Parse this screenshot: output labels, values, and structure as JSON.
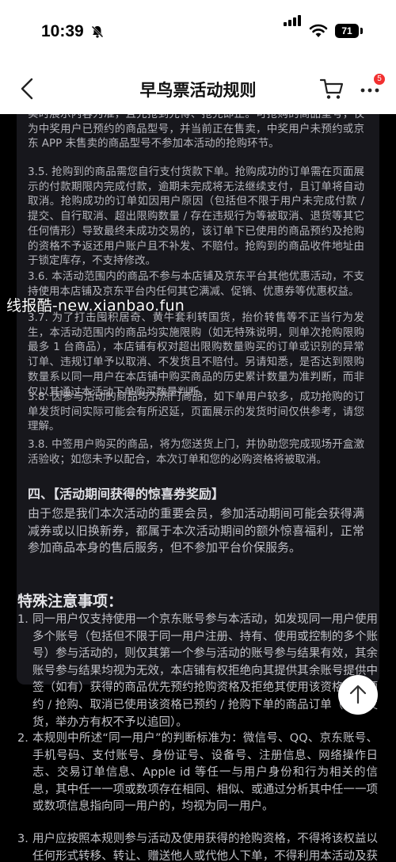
{
  "status": {
    "time": "10:39",
    "battery": "71"
  },
  "nav": {
    "title": "早鸟票活动规则",
    "badge_count": "5"
  },
  "rules": [
    "实时展示内容为准，且先抢到先得、抢完即止。可抢购的商品型号，仅为中奖用户已预约的商品型号，并当前正在售卖，中奖用户未预约或京东 APP 未售卖的商品型号不参加本活动的抢购环节。",
    "3.5. 抢购到的商品需您自行支付货款下单。抢购成功的订单需在页面展示的付款期限内完成付款，逾期未完成将无法继续支付，且订单将自动取消。抢购成功的订单如因用户原因（包括但不限于用户未完成付款 / 提交、自行取消、超出限购数量 / 存在违规行为等被取消、退货等其它任何情形）导致最终未成功交易的，该订单下已使用的商品预约及抢购的资格不予返还用户账户且不补发、不赔付。抢购到的商品收件地址由于锁定库存，不支持修改。",
    "3.6. 本活动范围内的商品不参与本店铺及京东平台其他优惠活动，不支持使用本店铺及京东平台内任何其它满减、促销、优惠券等优惠权益。",
    "3.7. 为了打击囤积居奇、黄牛套利转国货，抬价转售等不正当行为发生，本活动范围内的商品均实施限购（如无特殊说明，则单次抢购限购最多 1 台商品），本店铺有权对超出限购数量购买的订单或识别的异常订单、违规订单予以取消、不发货且不赔付。另请知悉，是否达到限购数量系以同一用户在本店铺中购买商品的历史累计数量为准判断，而非仅以其通过本活动下单购买数量判断。",
    "3.8. 因参与活动的商品均为热门商品，如下单用户较多，成功抢购的订单发货时间实际可能会有所迟延，页面展示的发货时间仅供参考，请您理解。",
    "3.8. 中签用户购买的商品，将为您送货上门，并协助您完成现场开盒激活验收；如您未予以配合，本次订单和您的必购资格将被取消。"
  ],
  "section4": {
    "title": "四、【活动期间获得的惊喜券奖励】",
    "body": "由于您是我们本次活动的重要会员，参加活动期间可能会获得满减券或以旧换新券，都属于本次活动期间的额外惊喜福利，正常参加商品本身的售后服务，但不参加平台价保服务。"
  },
  "notes": {
    "title": "特殊注意事项：",
    "items": [
      {
        "num": "1.",
        "text": "同一用户仅支持使用一个京东账号参与本活动，如发现同一用户使用多个账号（包括但不限于同一用户注册、持有、使用或控制的多个账号）参与活动的，则仅其第一个参与活动的账号参与结果有效，其余账号参与结果均视为无效，本店铺有权拒绝向其提供其余账号提供中签（如有）获得的商品优先预约抢购资格及拒绝其使用该资格参与预约 / 抢购、取消已使用该资格已预约 / 抢购下单的商品订单（如已发货，举办方有权不予以追回）。"
      },
      {
        "num": "2.",
        "text": "本规则中所述“同一用户”的判断标准为：微信号、QQ、京东账号、手机号码、支付账号、身份证号、设备号、注册信息、网络操作日志、交易订单信息、Apple id 等任一与用户身份和行为相关的信息，其中任一一项或数项存在相同、相似、或通过分析其中任一一项或数项信息指向同一用户的，均视为同一用户。"
      },
      {
        "num": "3.",
        "text": "用户应按照本规则参与活动及使用获得的抢购资格，不得将该权益以任何形式转移、转让、赠送他人或代他人下单，不得利用本活动及获取的权益进行盈利或非法获利、套现、套取优惠利差，不得将参与本活动获"
      }
    ]
  },
  "watermark": "线报酷-new.xianbao.fun",
  "icons": {
    "back": "chevron-left-icon",
    "cart": "cart-icon",
    "more": "more-dots-icon",
    "bell": "bell-slash-icon",
    "signal": "cellular-signal-icon",
    "wifi": "wifi-icon",
    "battery": "battery-icon",
    "to_top": "arrow-up-icon"
  },
  "colors": {
    "accent_badge": "#f23030",
    "card_bg": "#17171c",
    "page_bg": "#000000"
  }
}
